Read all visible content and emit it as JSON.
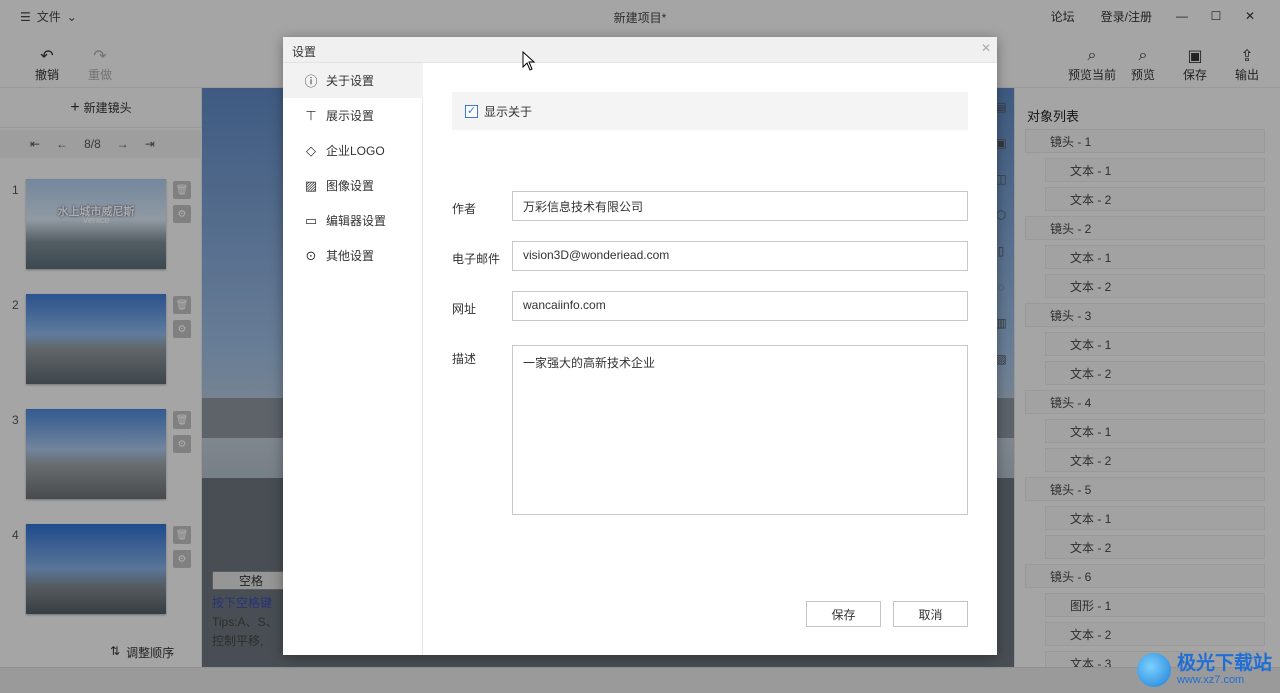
{
  "titlebar": {
    "menu_label": "文件",
    "title": "新建项目*",
    "forum_link": "论坛",
    "login_link": "登录/注册"
  },
  "toolbar": {
    "undo": "撤销",
    "redo": "重做",
    "preview_current": "预览当前",
    "preview": "预览",
    "save": "保存",
    "export": "输出"
  },
  "left_panel": {
    "new_shot": "新建镜头",
    "page_indicator": "8/8",
    "slides": [
      {
        "num": "1",
        "thumb_title": "水上城市威尼斯",
        "thumb_subtitle": "Venice"
      },
      {
        "num": "2"
      },
      {
        "num": "3"
      },
      {
        "num": "4"
      }
    ],
    "reorder": "调整顺序"
  },
  "viewport": {
    "key_label": "空格",
    "line1": "按下空格键",
    "line2": "Tips:A、S、",
    "line3": "控制平移,"
  },
  "object_list": {
    "title": "对象列表",
    "items": [
      {
        "label": "镜头 - 1",
        "level": 1
      },
      {
        "label": "文本 - 1",
        "level": 2
      },
      {
        "label": "文本 - 2",
        "level": 2
      },
      {
        "label": "镜头 - 2",
        "level": 1
      },
      {
        "label": "文本 - 1",
        "level": 2
      },
      {
        "label": "文本 - 2",
        "level": 2
      },
      {
        "label": "镜头 - 3",
        "level": 1
      },
      {
        "label": "文本 - 1",
        "level": 2
      },
      {
        "label": "文本 - 2",
        "level": 2
      },
      {
        "label": "镜头 - 4",
        "level": 1
      },
      {
        "label": "文本 - 1",
        "level": 2
      },
      {
        "label": "文本 - 2",
        "level": 2
      },
      {
        "label": "镜头 - 5",
        "level": 1
      },
      {
        "label": "文本 - 1",
        "level": 2
      },
      {
        "label": "文本 - 2",
        "level": 2
      },
      {
        "label": "镜头 - 6",
        "level": 1
      },
      {
        "label": "图形 - 1",
        "level": 2
      },
      {
        "label": "文本 - 2",
        "level": 2
      },
      {
        "label": "文本 - 3",
        "level": 2
      }
    ]
  },
  "dialog": {
    "title": "设置",
    "nav": [
      {
        "label": "关于设置",
        "icon": "info-icon"
      },
      {
        "label": "展示设置",
        "icon": "presentation-icon"
      },
      {
        "label": "企业LOGO",
        "icon": "diamond-icon"
      },
      {
        "label": "图像设置",
        "icon": "image-icon"
      },
      {
        "label": "编辑器设置",
        "icon": "monitor-icon"
      },
      {
        "label": "其他设置",
        "icon": "more-icon"
      }
    ],
    "show_about_label": "显示关于",
    "show_about_checked": true,
    "author_label": "作者",
    "author_value": "万彩信息技术有限公司",
    "email_label": "电子邮件",
    "email_value": "vision3D@wonderiead.com",
    "url_label": "网址",
    "url_value": "wancaiinfo.com",
    "desc_label": "描述",
    "desc_value": "一家强大的高新技术企业",
    "save_button": "保存",
    "cancel_button": "取消"
  },
  "watermark": {
    "name": "极光下载站",
    "url": "www.xz7.com"
  }
}
